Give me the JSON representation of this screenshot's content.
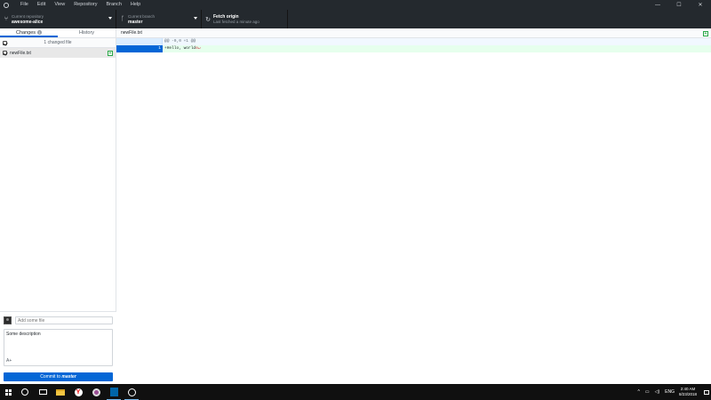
{
  "menu": [
    "File",
    "Edit",
    "View",
    "Repository",
    "Branch",
    "Help"
  ],
  "window_controls": {
    "minimize": "—",
    "maximize": "☐",
    "close": "✕"
  },
  "toolbar": {
    "repo": {
      "label": "Current repository",
      "value": "awesome-alice"
    },
    "branch": {
      "label": "Current branch",
      "value": "master"
    },
    "fetch": {
      "title": "Fetch origin",
      "subtitle": "Last fetched a minute ago"
    }
  },
  "sidebar": {
    "tabs": [
      {
        "label": "Changes",
        "badge": "1",
        "active": true
      },
      {
        "label": "History",
        "active": false
      }
    ],
    "changed_count": "1 changed file",
    "files": [
      {
        "name": "newFile.txt",
        "status": "+"
      }
    ]
  },
  "commit": {
    "summary_placeholder": "Add some file",
    "description": "Some description",
    "coauthor_icon": "A+",
    "button_prefix": "Commit to ",
    "button_branch": "master"
  },
  "diff": {
    "filename": "newFile.txt",
    "hunk": "@@ -0,0 +1 @@",
    "lines": [
      {
        "new_number": "1",
        "text": "+Hello, world",
        "no_newline_marker": "⊖↵"
      }
    ]
  },
  "taskbar": {
    "tray_lang": "ENG",
    "time": "2:40 AM",
    "date": "8/23/2018"
  },
  "colors": {
    "accent": "#0366d6",
    "add_bg": "#e6ffed",
    "dark_bar": "#24292e"
  }
}
